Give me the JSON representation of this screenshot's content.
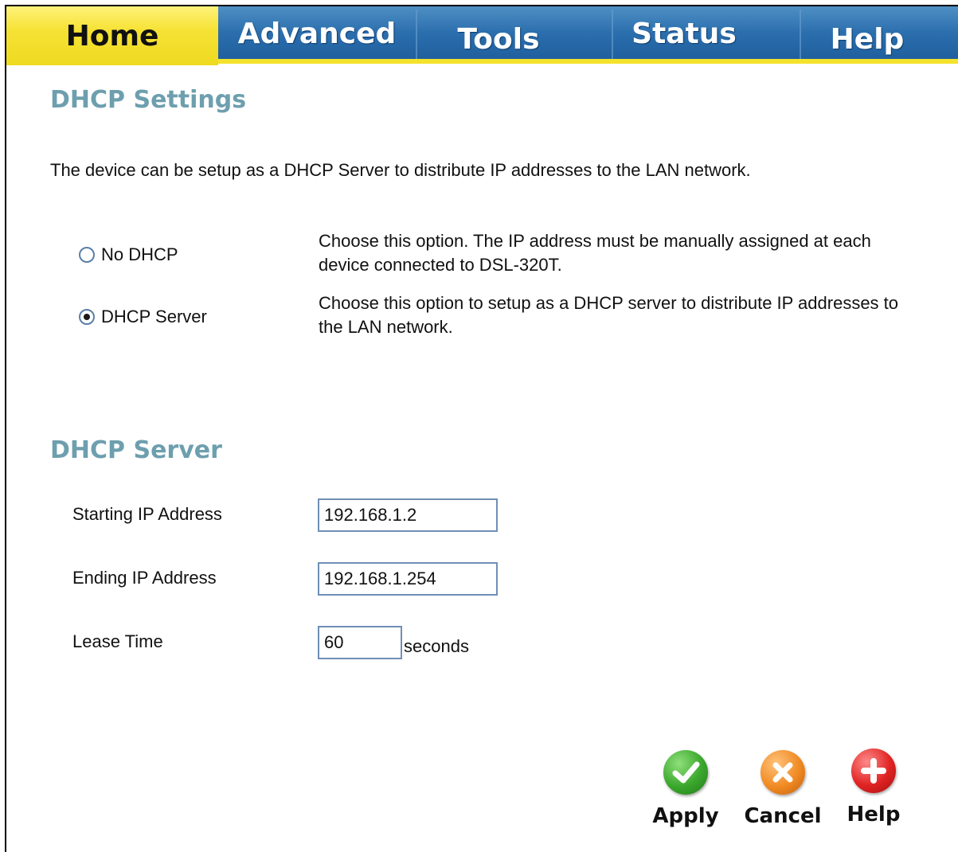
{
  "tabs": [
    {
      "label": "Home",
      "active": true
    },
    {
      "label": "Advanced",
      "active": false
    },
    {
      "label": "Tools",
      "active": false
    },
    {
      "label": "Status",
      "active": false
    },
    {
      "label": "Help",
      "active": false
    }
  ],
  "dhcp_settings": {
    "title": "DHCP Settings",
    "intro": "The device can be setup as a DHCP Server to distribute IP addresses to the LAN network.",
    "options": [
      {
        "label": "No DHCP",
        "checked": false,
        "description": "Choose this option. The IP address must be manually assigned at each device connected to DSL-320T."
      },
      {
        "label": "DHCP Server",
        "checked": true,
        "description": "Choose this option to setup as a DHCP server to distribute IP addresses to the LAN network."
      }
    ]
  },
  "dhcp_server": {
    "title": "DHCP Server",
    "starting_ip_label": "Starting IP Address",
    "starting_ip_value": "192.168.1.2",
    "ending_ip_label": "Ending IP Address",
    "ending_ip_value": "192.168.1.254",
    "lease_time_label": "Lease Time",
    "lease_time_value": "60",
    "lease_time_unit": "seconds"
  },
  "actions": {
    "apply": "Apply",
    "cancel": "Cancel",
    "help": "Help"
  },
  "colors": {
    "tab_active": "#f6e235",
    "tab_bar": "#2c6fae",
    "section_title": "#6d9fae"
  },
  "icons": {
    "apply": "checkmark-icon",
    "cancel": "x-icon",
    "help": "plus-icon"
  }
}
